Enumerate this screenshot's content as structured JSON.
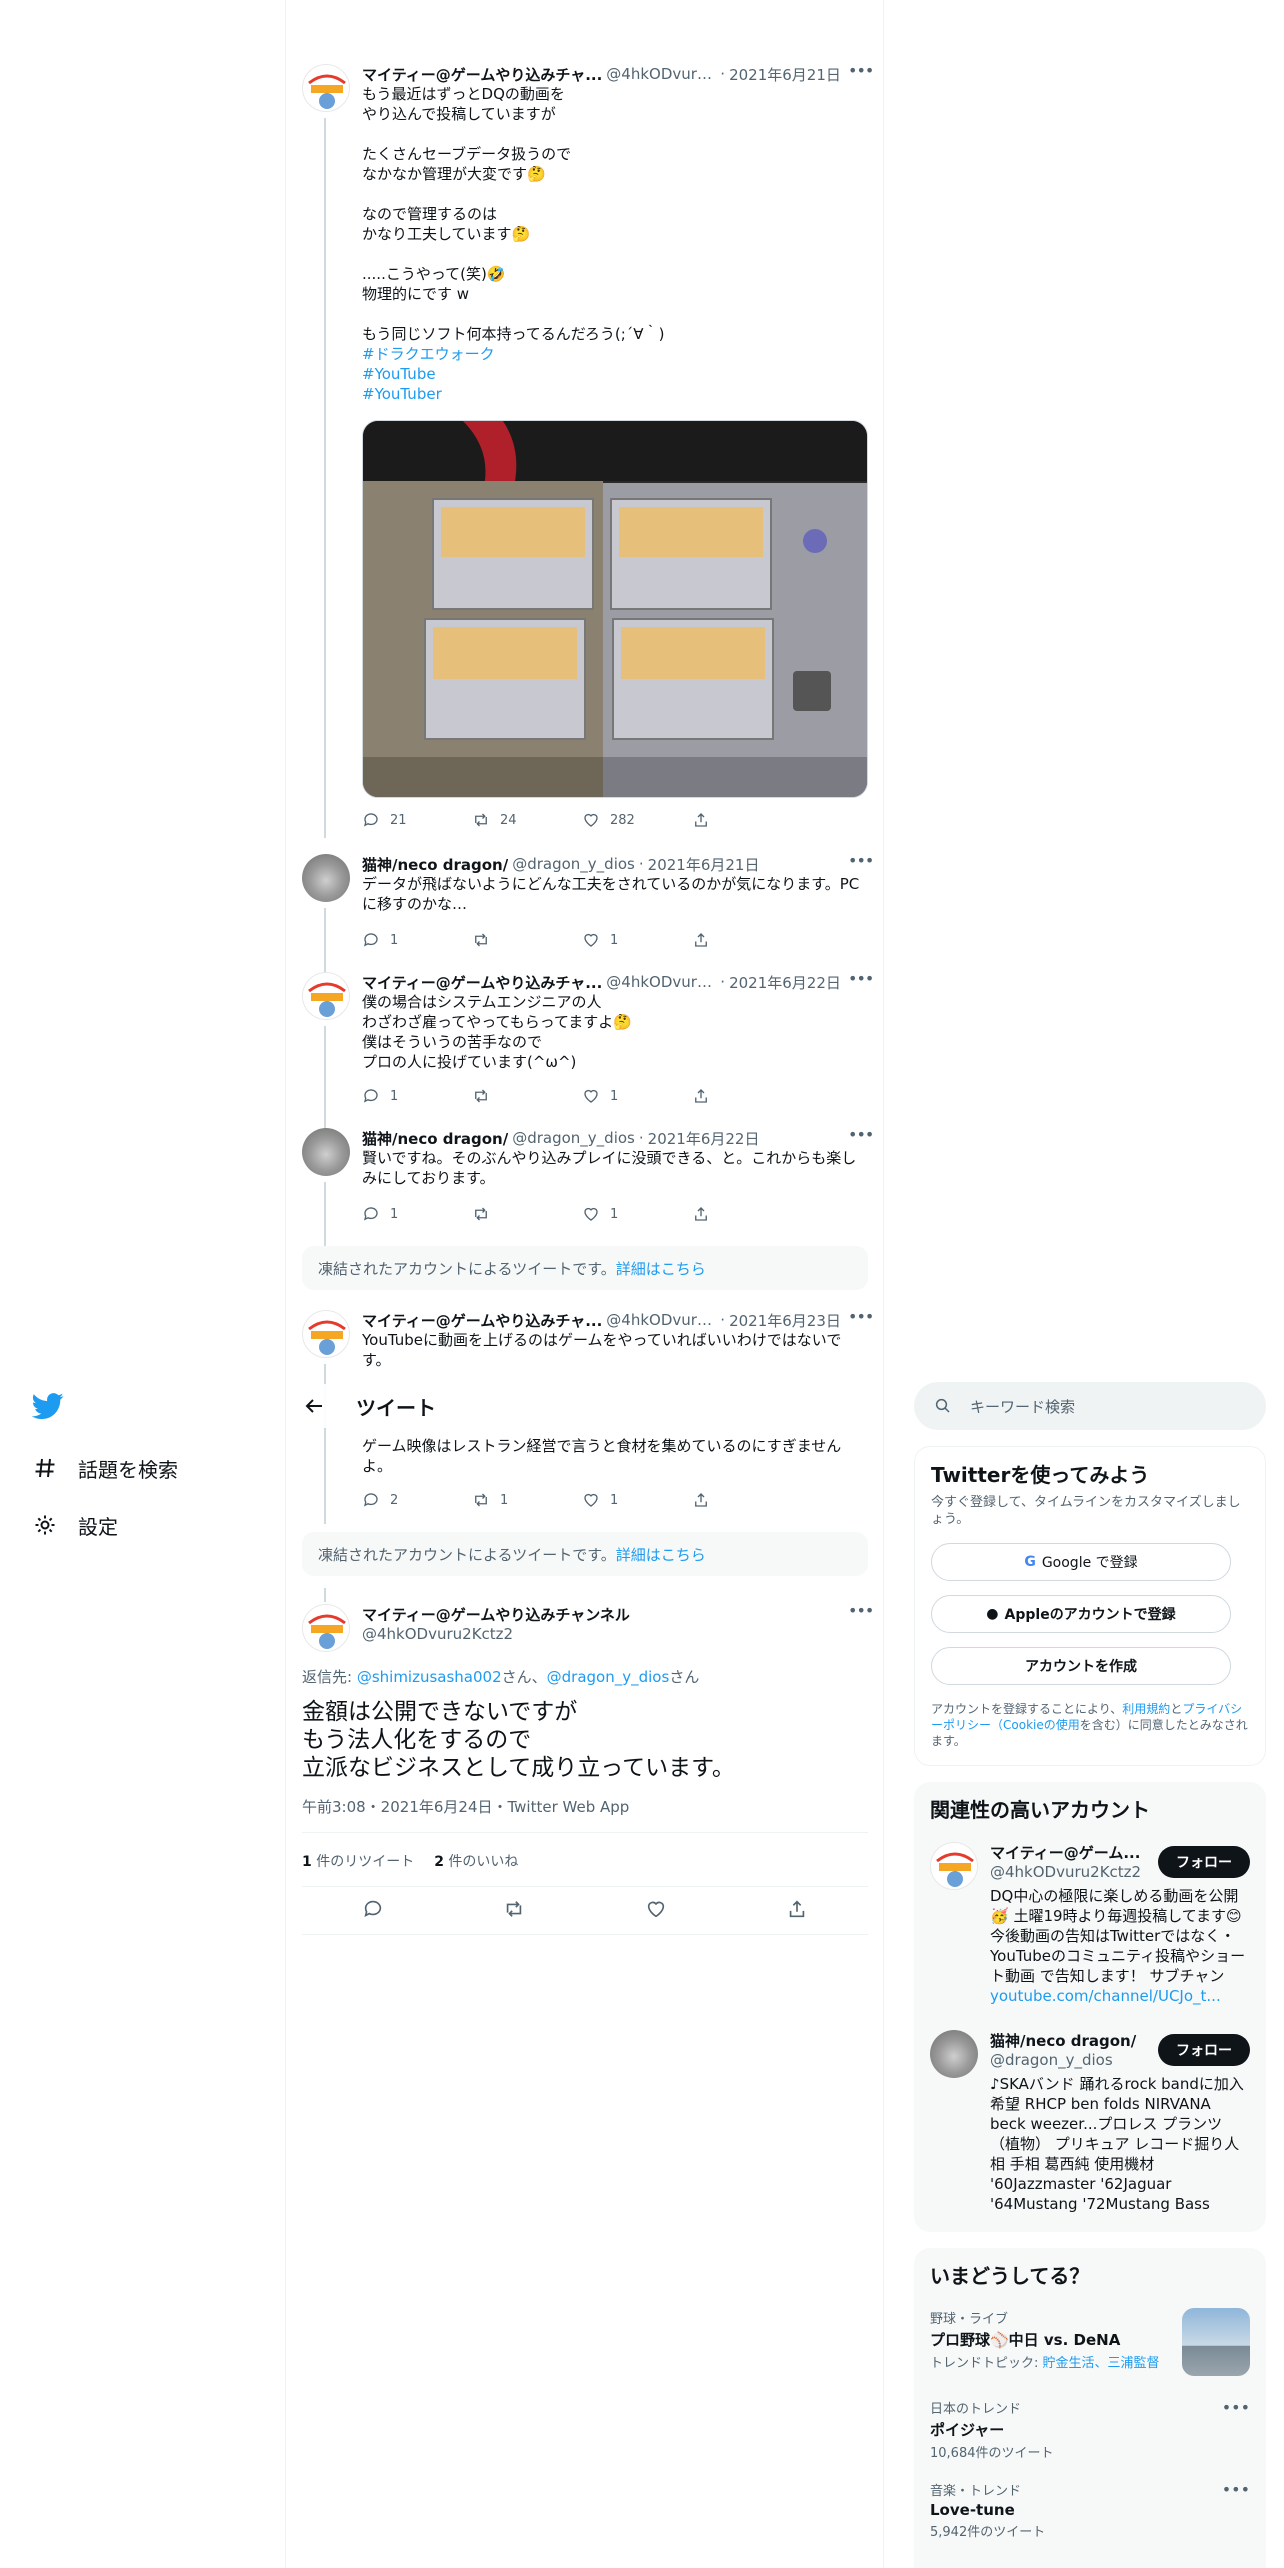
{
  "nav": {
    "explore": "話題を検索",
    "settings": "設定"
  },
  "header": {
    "title": "ツイート"
  },
  "tweets": [
    {
      "name": "マイティー@ゲームやり込みチャ...",
      "handle": "@4hkODvuru...",
      "date": "2021年6月21日",
      "text": "もう最近はずっとDQの動画を\nやり込んで投稿していますが\n\nたくさんセーブデータ扱うので\nなかなか管理が大変です🤔\n\nなので管理するのは\nかなり工夫しています🤔\n\n.....こうやって(笑)🤣\n物理的にです w\n\nもう同じソフト何本持ってるんだろう(;´∀｀)",
      "tags": [
        "#ドラクエウォーク",
        "#YouTube",
        "#YouTuber"
      ],
      "replies": "21",
      "retweets": "24",
      "likes": "282"
    },
    {
      "name": "猫神/neco dragon/",
      "handle": "@dragon_y_dios",
      "date": "2021年6月21日",
      "text": "データが飛ばないようにどんな工夫をされているのかが気になります。PCに移すのかな…",
      "replies": "1",
      "retweets": "",
      "likes": "1"
    },
    {
      "name": "マイティー@ゲームやり込みチャ...",
      "handle": "@4hkODvuru...",
      "date": "2021年6月22日",
      "text": "僕の場合はシステムエンジニアの人\nわざわざ雇ってやってもらってますよ🤔\n僕はそういうの苦手なので\nプロの人に投げています(^ω^)",
      "replies": "1",
      "retweets": "",
      "likes": "1"
    },
    {
      "name": "猫神/neco dragon/",
      "handle": "@dragon_y_dios",
      "date": "2021年6月22日",
      "text": "賢いですね。そのぶんやり込みプレイに没頭できる、と。これからも楽しみにしております。",
      "replies": "1",
      "retweets": "",
      "likes": "1"
    },
    {
      "name": "マイティー@ゲームやり込みチャ...",
      "handle": "@4hkODvuru...",
      "date": "2021年6月23日",
      "text_top": "YouTubeに動画を上げるのはゲームをやっていればいいわけではないです。",
      "text_bottom": "ゲーム映像はレストラン経営で言うと食材を集めているのにすぎませんよ。",
      "replies": "2",
      "retweets": "1",
      "likes": "1"
    }
  ],
  "notice": {
    "text": "凍結されたアカウントによるツイートです。",
    "link": "詳細はこちら"
  },
  "focus": {
    "name": "マイティー@ゲームやり込みチャンネル",
    "handle": "@4hkODvuru2Kctz2",
    "reply_label": "返信先: ",
    "reply_user1": "@shimizusasha002",
    "san1": "さん、",
    "reply_user2": "@dragon_y_dios",
    "san2": "さん",
    "text": "金額は公開できないですが\nもう法人化をするので\n立派なビジネスとして成り立っています。",
    "timestamp": "午前3:08・2021年6月24日・Twitter Web App",
    "retweet_count": "1",
    "retweet_label": "件のリツイート",
    "like_count": "2",
    "like_label": "件のいいね"
  },
  "sidebar": {
    "search_placeholder": "キーワード検索",
    "signup": {
      "title": "Twitterを使ってみよう",
      "subtitle": "今すぐ登録して、タイムラインをカスタマイズしましょう。",
      "google": "Google で登録",
      "apple": "Appleのアカウントで登録",
      "create": "アカウントを作成",
      "legal_1": "アカウントを登録することにより、",
      "terms": "利用規約",
      "legal_2": "と",
      "privacy": "プライバシーポリシー（Cookieの使用",
      "legal_3": "を含む）に同意したとみなされます。"
    },
    "related": {
      "title": "関連性の高いアカウント",
      "follow_label": "フォロー",
      "accounts": [
        {
          "name": "マイティー@ゲーム...",
          "handle": "@4hkODvuru2Kctz2",
          "bio": "DQ中心の極限に楽しめる動画を公開🥳 土曜19時より毎週投稿してます😊 今後動画の告知はTwitterではなく・YouTubeのコミュニティ投稿やショート動画 で告知します！ サブチャン",
          "link": "youtube.com/channel/UCJo_t..."
        },
        {
          "name": "猫神/neco dragon/",
          "handle": "@dragon_y_dios",
          "bio": "♪SKAバンド 踊れるrock bandに加入希望 RHCP ben folds NIRVANA beck weezer...プロレス プランツ（植物） プリキュア レコード掘り人相 手相 葛西純 使用機材 '60Jazzmaster '62Jaguar '64Mustang '72Mustang Bass",
          "link": ""
        }
      ]
    },
    "trends": {
      "title": "いまどうしてる？",
      "items": [
        {
          "context": "野球・ライブ",
          "name": "プロ野球⚾中日 vs. DeNA",
          "extra_label": "トレンドトピック: ",
          "extra_links": "貯金生活、三浦監督"
        },
        {
          "context": "日本のトレンド",
          "name": "ポイジャー",
          "count": "10,684件のツイート"
        },
        {
          "context": "音楽・トレンド",
          "name": "Love-tune",
          "count": "5,942件のツイート"
        }
      ]
    }
  },
  "colors": {
    "accent": "#1d9bf0",
    "text": "#0f1419",
    "muted": "#536471",
    "border": "#eff3f4"
  }
}
